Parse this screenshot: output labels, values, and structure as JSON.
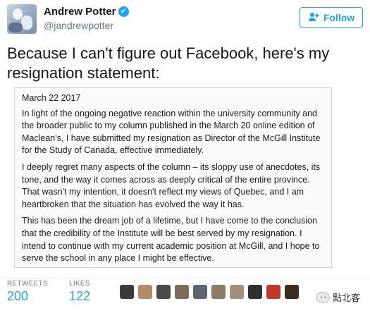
{
  "header": {
    "name": "Andrew Potter",
    "handle": "@jandrewpotter",
    "verified_glyph": "✔",
    "follow_label": "Follow",
    "follow_icon": "person-plus-icon"
  },
  "tweet": {
    "text": "Because I can't figure out Facebook, here's my resignation statement:"
  },
  "statement": {
    "date": "March 22 2017",
    "paragraphs": [
      "In light of the ongoing negative reaction within the university community and the broader public to my column published in the March 20 online edition of Maclean's, I have submitted my resignation as Director of the McGill Institute for the Study of Canada, effective immediately.",
      "I deeply regret many aspects of the column – its sloppy use of anecdotes, its tone, and the way it comes across as deeply critical of the entire province. That wasn't my intention, it doesn't reflect my views of Quebec, and I am heartbroken that the situation has evolved the way it has.",
      "This has been the dream job of a lifetime, but I have come to the conclusion that the credibility of the Institute will be best served by my resignation. I intend to continue with my current academic position at McGill, and I hope to serve the school in any place I might be effective."
    ]
  },
  "stats": {
    "retweets_label": "RETWEETS",
    "retweets_value": "200",
    "likes_label": "LIKES",
    "likes_value": "122"
  },
  "likers": [
    {
      "color": "#3b3b3b"
    },
    {
      "color": "#b38a6a"
    },
    {
      "color": "#4a4a4a"
    },
    {
      "color": "#7a6d5a"
    },
    {
      "color": "#5b6670"
    },
    {
      "color": "#8e7b66"
    },
    {
      "color": "#a58f7a"
    },
    {
      "color": "#2f2f2f"
    },
    {
      "color": "#c0392b"
    },
    {
      "color": "#3d2b20"
    }
  ],
  "watermark": {
    "text": "點北客"
  },
  "colors": {
    "accent": "#1da1f2",
    "text": "#14171a",
    "muted": "#657786"
  }
}
